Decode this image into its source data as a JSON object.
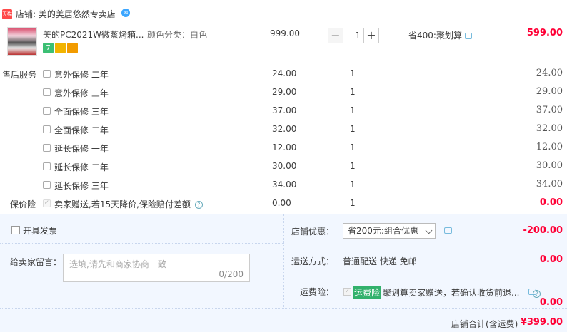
{
  "shop": {
    "badge": "天猫",
    "label": "店铺:",
    "name": "美的美居悠然专卖店",
    "ww_icon": "wangwang-icon"
  },
  "item": {
    "title": "美的PC2021W微蒸烤箱...",
    "sku": "颜色分类：白色",
    "price": "999.00",
    "quantity": "1",
    "minus": "−",
    "plus": "+",
    "promo": "省400:聚划算",
    "subtotal": "599.00",
    "tag_colors": [
      "#3cbf74",
      "#f2b400",
      "#f29b00"
    ]
  },
  "services": {
    "title": "售后服务",
    "rows": [
      {
        "name": "意外保修 二年",
        "price": "24.00",
        "qty": "1",
        "total": "24.00"
      },
      {
        "name": "意外保修 三年",
        "price": "29.00",
        "qty": "1",
        "total": "29.00"
      },
      {
        "name": "全面保修 三年",
        "price": "37.00",
        "qty": "1",
        "total": "37.00"
      },
      {
        "name": "全面保修 二年",
        "price": "32.00",
        "qty": "1",
        "total": "32.00"
      },
      {
        "name": "延长保修 一年",
        "price": "12.00",
        "qty": "1",
        "total": "12.00"
      },
      {
        "name": "延长保修 二年",
        "price": "30.00",
        "qty": "1",
        "total": "30.00"
      },
      {
        "name": "延长保修 三年",
        "price": "34.00",
        "qty": "1",
        "total": "34.00"
      }
    ]
  },
  "price_protect": {
    "title": "保价险",
    "check": "✓",
    "text": "卖家赠送,若15天降价,保险赔付差额",
    "help": "?",
    "price": "0.00",
    "qty": "1",
    "total": "0.00"
  },
  "invoice": {
    "label": "开具发票"
  },
  "message": {
    "label": "给卖家留言：",
    "placeholder": "选填,请先和商家协商一致",
    "count": "0/200"
  },
  "discount": {
    "label": "店铺优惠：",
    "selected": "省200元:组合优惠",
    "amount": "-200.00"
  },
  "shipping": {
    "label": "运送方式：",
    "value": "普通配送 快递 免邮",
    "amount": "0.00"
  },
  "freight_ins": {
    "label": "运费险：",
    "check": "✓",
    "tag": "运费险",
    "text": "聚划算卖家赠送，若确认收货前退...",
    "amount": "0.00"
  },
  "total": {
    "label": "店铺合计(含运费)",
    "value": "¥399.00"
  }
}
